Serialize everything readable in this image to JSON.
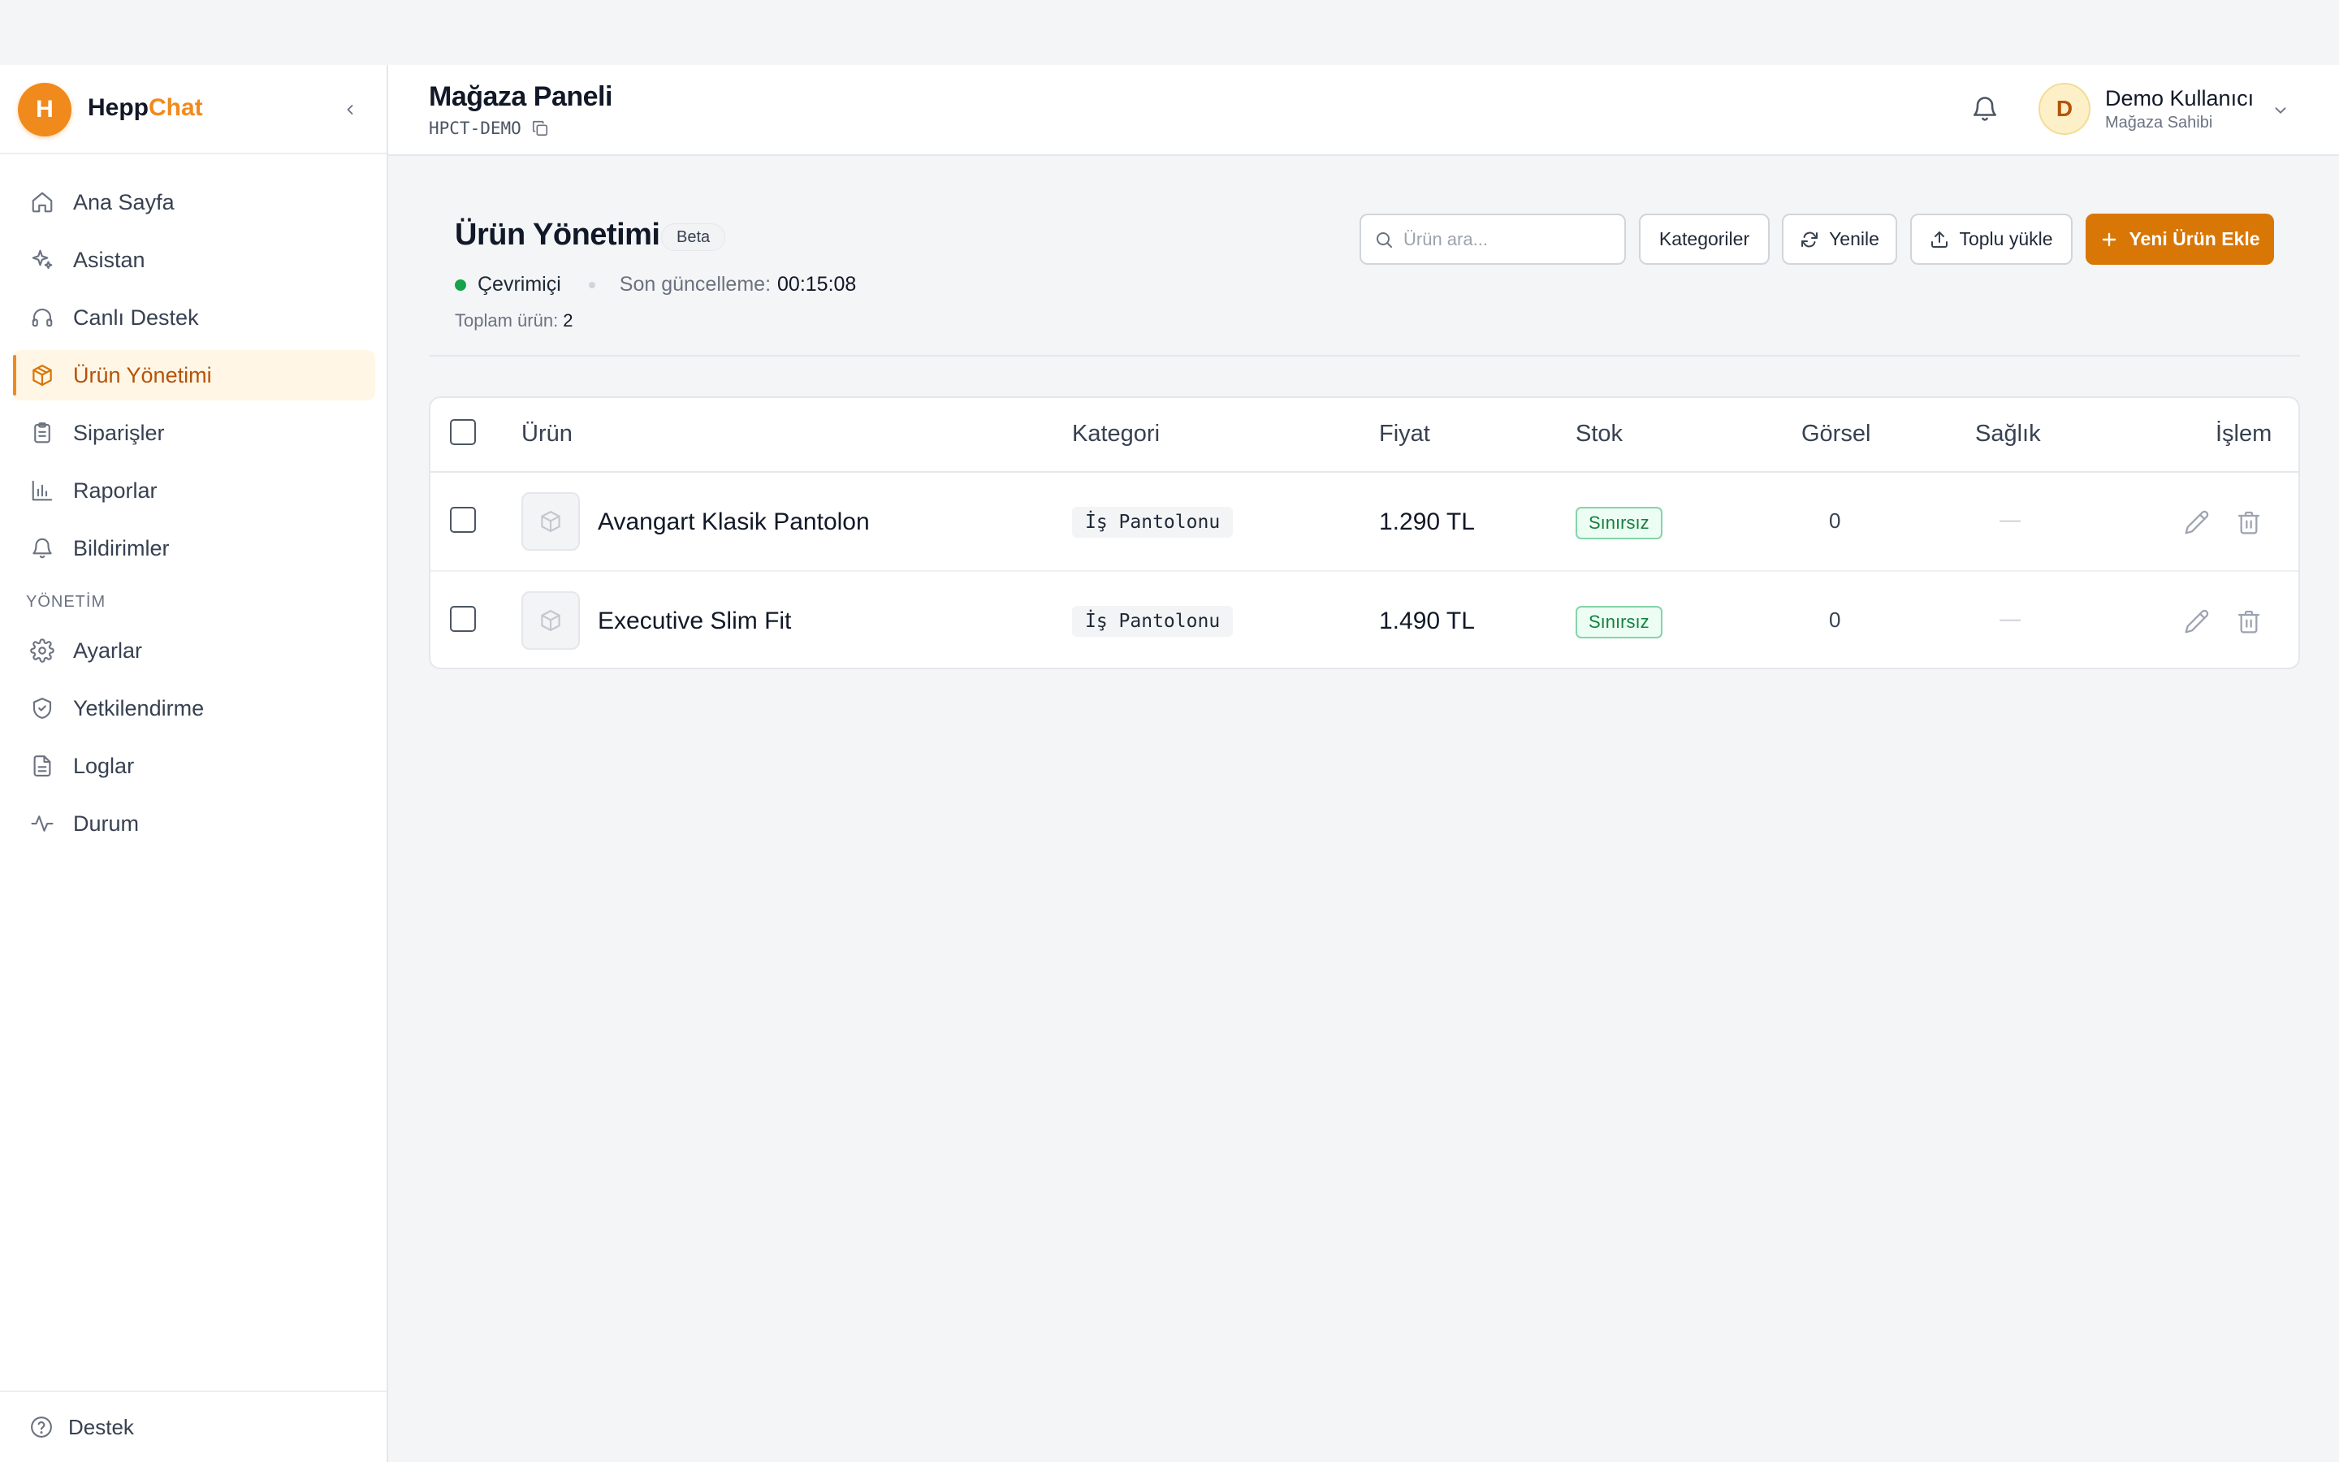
{
  "brand": {
    "logo_letter": "H",
    "name_part1": "Hepp",
    "name_part2": "Chat",
    "accent_color": "#f18a1c"
  },
  "sidebar": {
    "items": [
      {
        "label": "Ana Sayfa",
        "icon": "home-icon",
        "active": false
      },
      {
        "label": "Asistan",
        "icon": "sparkles-icon",
        "active": false
      },
      {
        "label": "Canlı Destek",
        "icon": "headphones-icon",
        "active": false
      },
      {
        "label": "Ürün Yönetimi",
        "icon": "package-icon",
        "active": true
      },
      {
        "label": "Siparişler",
        "icon": "clipboard-icon",
        "active": false
      },
      {
        "label": "Raporlar",
        "icon": "bar-chart-icon",
        "active": false
      },
      {
        "label": "Bildirimler",
        "icon": "bell-icon",
        "active": false
      }
    ],
    "section_label": "YÖNETİM",
    "admin_items": [
      {
        "label": "Ayarlar",
        "icon": "gear-icon"
      },
      {
        "label": "Yetkilendirme",
        "icon": "shield-icon"
      },
      {
        "label": "Loglar",
        "icon": "file-text-icon"
      },
      {
        "label": "Durum",
        "icon": "activity-icon"
      }
    ],
    "footer_label": "Destek"
  },
  "header": {
    "title": "Mağaza Paneli",
    "store_code": "HPCT-DEMO",
    "user_initial": "D",
    "user_name": "Demo Kullanıcı",
    "user_role": "Mağaza Sahibi"
  },
  "page": {
    "title": "Ürün Yönetimi",
    "badge": "Beta",
    "status": "Çevrimiçi",
    "last_update_label": "Son güncelleme:",
    "last_update_time": "00:15:08",
    "total_label": "Toplam ürün:",
    "total_count": "2"
  },
  "toolbar": {
    "search_placeholder": "Ürün ara...",
    "categories_label": "Kategoriler",
    "refresh_label": "Yenile",
    "bulk_upload_label": "Toplu yükle",
    "new_product_label": "Yeni Ürün Ekle"
  },
  "table": {
    "headers": {
      "product": "Ürün",
      "category": "Kategori",
      "price": "Fiyat",
      "stock": "Stok",
      "image": "Görsel",
      "health": "Sağlık",
      "action": "İşlem"
    },
    "rows": [
      {
        "name": "Avangart Klasik Pantolon",
        "category": "İş Pantolonu",
        "price": "1.290 TL",
        "stock": "Sınırsız",
        "images": "0",
        "health": "—"
      },
      {
        "name": "Executive Slim Fit",
        "category": "İş Pantolonu",
        "price": "1.490 TL",
        "stock": "Sınırsız",
        "images": "0",
        "health": "—"
      }
    ]
  }
}
